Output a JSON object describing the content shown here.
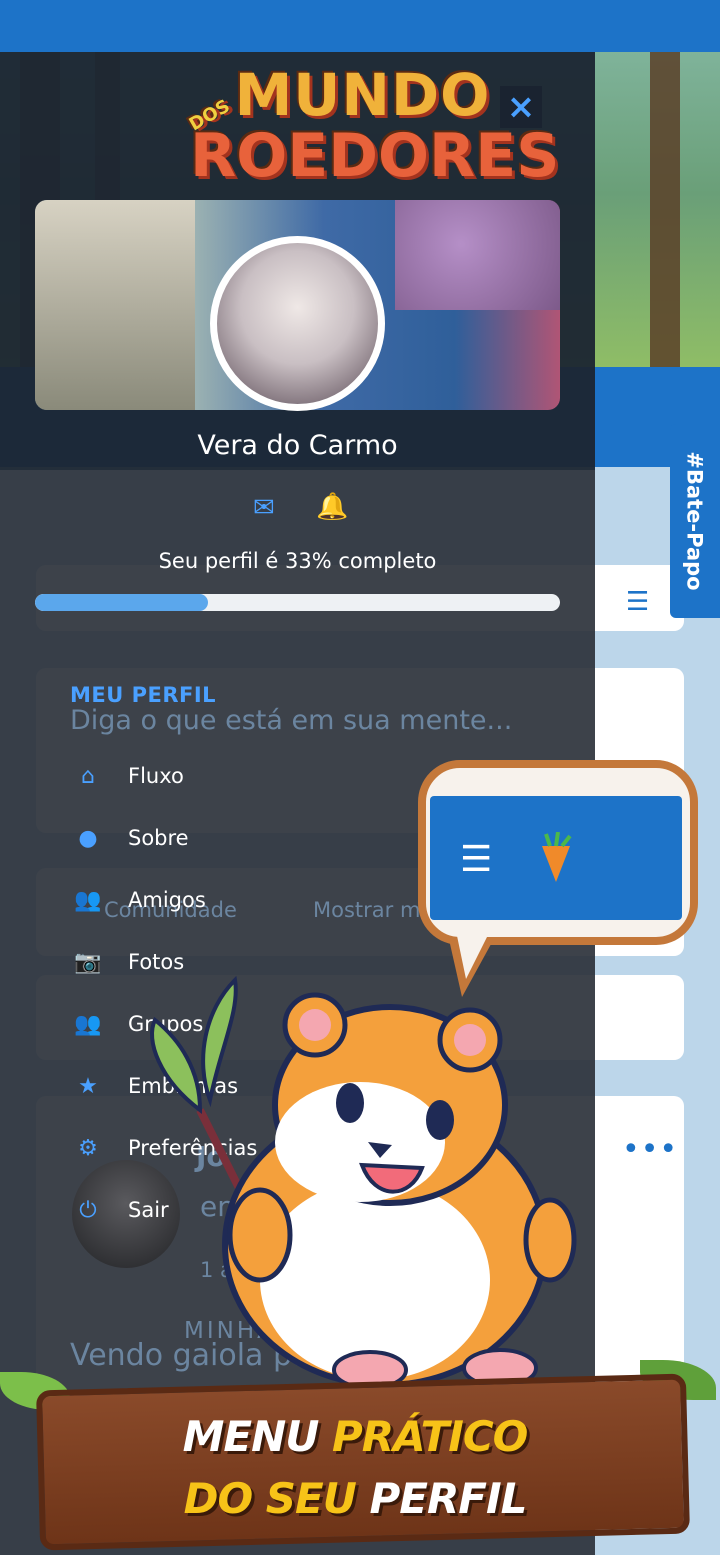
{
  "drawer": {
    "profile_name": "Vera do Carmo",
    "progress_label": "Seu perfil é 33% completo",
    "progress_percent": 33,
    "section_title": "MEU PERFIL",
    "close_icon": "×",
    "menu": [
      {
        "icon": "home-icon",
        "glyph": "⌂",
        "label": "Fluxo"
      },
      {
        "icon": "user-icon",
        "glyph": "●",
        "label": "Sobre"
      },
      {
        "icon": "users-icon",
        "glyph": "👥",
        "label": "Amigos"
      },
      {
        "icon": "camera-icon",
        "glyph": "📷",
        "label": "Fotos"
      },
      {
        "icon": "group-icon",
        "glyph": "👥",
        "label": "Grupos"
      },
      {
        "icon": "star-icon",
        "glyph": "★",
        "label": "Emblemas"
      },
      {
        "icon": "gear-icon",
        "glyph": "⚙",
        "label": "Preferências"
      },
      {
        "icon": "power-icon",
        "glyph": "⏻",
        "label": "Sair"
      }
    ]
  },
  "background": {
    "chat_tab": "#Bate-Papo",
    "post_placeholder": "Diga o que está em sua mente...",
    "tab_community": "Comunidade",
    "tab_show": "Mostrar m",
    "post_author": "Jo",
    "post_text_fragment": "env",
    "post_time": "1 ano atrá",
    "section_minhas": "MINHAS R",
    "post_body": "Vendo gaiola para"
  },
  "logo": {
    "prefix": "DOS",
    "line1": "MUNDO",
    "line2": "ROEDORES"
  },
  "sign": {
    "line1_white": "MENU ",
    "line1_yellow": "PRÁTICO",
    "line2_yellow": "DO SEU ",
    "line2_white": "PERFIL"
  },
  "colors": {
    "brand_blue": "#1d73c8",
    "accent_blue": "#4aa0ff",
    "sign_yellow": "#f7c318"
  }
}
